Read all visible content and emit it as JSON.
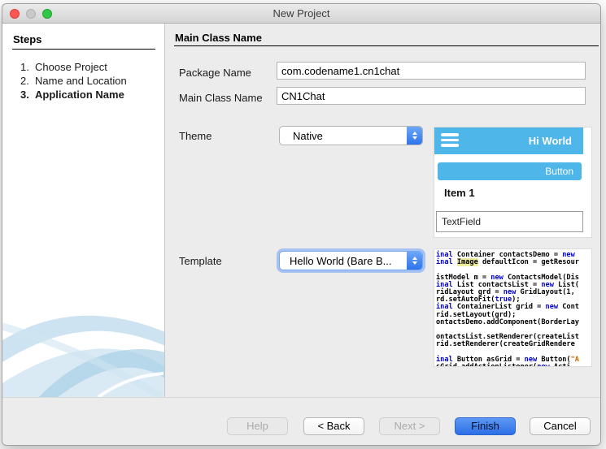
{
  "window": {
    "title": "New Project"
  },
  "sidebar": {
    "heading": "Steps",
    "steps": [
      {
        "number": "1.",
        "label": "Choose Project",
        "active": false
      },
      {
        "number": "2.",
        "label": "Name and Location",
        "active": false
      },
      {
        "number": "3.",
        "label": "Application Name",
        "active": true
      }
    ]
  },
  "main": {
    "heading": "Main Class Name",
    "package_label": "Package Name",
    "package_value": "com.codename1.cn1chat",
    "class_label": "Main Class Name",
    "class_value": "CN1Chat",
    "theme_label": "Theme",
    "theme_value": "Native",
    "template_label": "Template",
    "template_value": "Hello World (Bare B..."
  },
  "theme_preview": {
    "titlebar_text": "Hi World",
    "button_text": "Button",
    "item_text": "Item 1",
    "textfield_text": "TextField"
  },
  "code_preview": {
    "lines": [
      [
        [
          "k",
          "inal"
        ],
        [
          "p",
          " Container contactsDemo = "
        ],
        [
          "k",
          "new"
        ]
      ],
      [
        [
          "k",
          "inal"
        ],
        [
          "p",
          " "
        ],
        [
          "h",
          "Image"
        ],
        [
          "p",
          " defaultIcon = getResour"
        ]
      ],
      [
        [
          "p",
          ""
        ]
      ],
      [
        [
          "p",
          "istModel m = "
        ],
        [
          "k",
          "new"
        ],
        [
          "p",
          " ContactsModel(Dis"
        ]
      ],
      [
        [
          "k",
          "inal"
        ],
        [
          "p",
          " List contactsList = "
        ],
        [
          "k",
          "new"
        ],
        [
          "p",
          " List("
        ]
      ],
      [
        [
          "p",
          "ridLayout grd = "
        ],
        [
          "k",
          "new"
        ],
        [
          "p",
          " GridLayout(1,"
        ]
      ],
      [
        [
          "p",
          "rd.setAutoFit("
        ],
        [
          "k",
          "true"
        ],
        [
          "p",
          ");"
        ]
      ],
      [
        [
          "k",
          "inal"
        ],
        [
          "p",
          " ContainerList grid = "
        ],
        [
          "k",
          "new"
        ],
        [
          "p",
          " Cont"
        ]
      ],
      [
        [
          "p",
          "rid.setLayout(grd);"
        ]
      ],
      [
        [
          "p",
          "ontactsDemo.addComponent(BorderLay"
        ]
      ],
      [
        [
          "p",
          ""
        ]
      ],
      [
        [
          "p",
          "ontactsList.setRenderer(createList"
        ]
      ],
      [
        [
          "p",
          "rid.setRenderer(createGridRendere"
        ]
      ],
      [
        [
          "p",
          ""
        ]
      ],
      [
        [
          "k",
          "inal"
        ],
        [
          "p",
          " Button asGrid = "
        ],
        [
          "k",
          "new"
        ],
        [
          "p",
          " Button("
        ],
        [
          "s",
          "\"A"
        ]
      ],
      [
        [
          "p",
          "sGrid.addActionListener("
        ],
        [
          "k",
          "new"
        ],
        [
          "p",
          " Acti"
        ]
      ]
    ]
  },
  "footer": {
    "help_label": "Help",
    "back_label": "< Back",
    "next_label": "Next >",
    "finish_label": "Finish",
    "cancel_label": "Cancel"
  },
  "colors": {
    "theme_blue": "#4fb6e9",
    "finish_blue": "#2d70e6",
    "keyword_blue": "#0000cc",
    "string_orange": "#cc6a00",
    "highlight_yellow": "#eeec9d",
    "panel_gray": "#ececec"
  }
}
